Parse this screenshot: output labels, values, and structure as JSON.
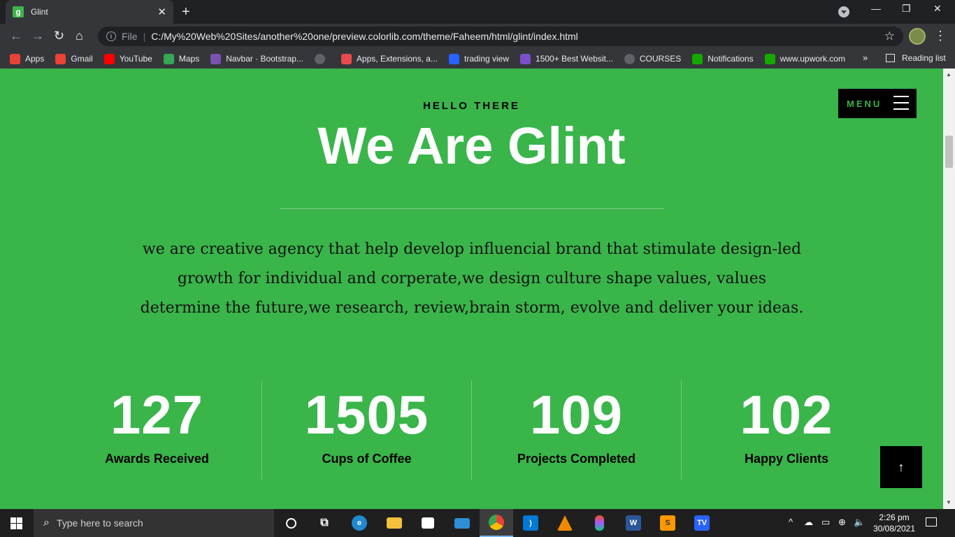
{
  "browser": {
    "tab_title": "Glint",
    "tab_favicon_letter": "g",
    "address_prefix": "File",
    "url": "C:/My%20Web%20Sites/another%20one/preview.colorlib.com/theme/Faheem/html/glint/index.html",
    "bookmarks": [
      {
        "label": "Apps",
        "icon": "apps-grid-icon",
        "color": "#ea4335"
      },
      {
        "label": "Gmail",
        "icon": "gmail-icon",
        "color": "#ea4335"
      },
      {
        "label": "YouTube",
        "icon": "youtube-icon",
        "color": "#ff0000"
      },
      {
        "label": "Maps",
        "icon": "maps-icon",
        "color": "#34a853"
      },
      {
        "label": "Navbar · Bootstrap...",
        "icon": "bootstrap-icon",
        "color": "#7952b3"
      },
      {
        "label": "",
        "icon": "globe-icon",
        "color": "#5f6368"
      },
      {
        "label": "Apps, Extensions, a...",
        "icon": "extensions-icon",
        "color": "#e94a4a"
      },
      {
        "label": "trading view",
        "icon": "tradingview-icon",
        "color": "#2962ff"
      },
      {
        "label": "1500+ Best Websit...",
        "icon": "colorlib-icon",
        "color": "#7b4fc9"
      },
      {
        "label": "COURSES",
        "icon": "globe-icon",
        "color": "#5f6368"
      },
      {
        "label": "Notifications",
        "icon": "upwork-icon",
        "color": "#14a800"
      },
      {
        "label": "www.upwork.com",
        "icon": "upwork-icon",
        "color": "#14a800"
      }
    ],
    "more_bookmarks": "»",
    "reading_list": "Reading list"
  },
  "page": {
    "menu_label": "MENU",
    "hello": "HELLO THERE",
    "title": "We Are Glint",
    "description": "we are creative agency that help develop influencial brand that stimulate design-led growth for individual and corperate,we design culture shape values, values determine the future,we research, review,brain storm, evolve and deliver your ideas.",
    "stats": [
      {
        "value": "127",
        "label": "Awards Received"
      },
      {
        "value": "1505",
        "label": "Cups of Coffee"
      },
      {
        "value": "109",
        "label": "Projects Completed"
      },
      {
        "value": "102",
        "label": "Happy Clients"
      }
    ],
    "back_to_top": "↑",
    "accent_color": "#39b54a"
  },
  "taskbar": {
    "search_placeholder": "Type here to search",
    "time": "2:26 pm",
    "date": "30/08/2021"
  }
}
